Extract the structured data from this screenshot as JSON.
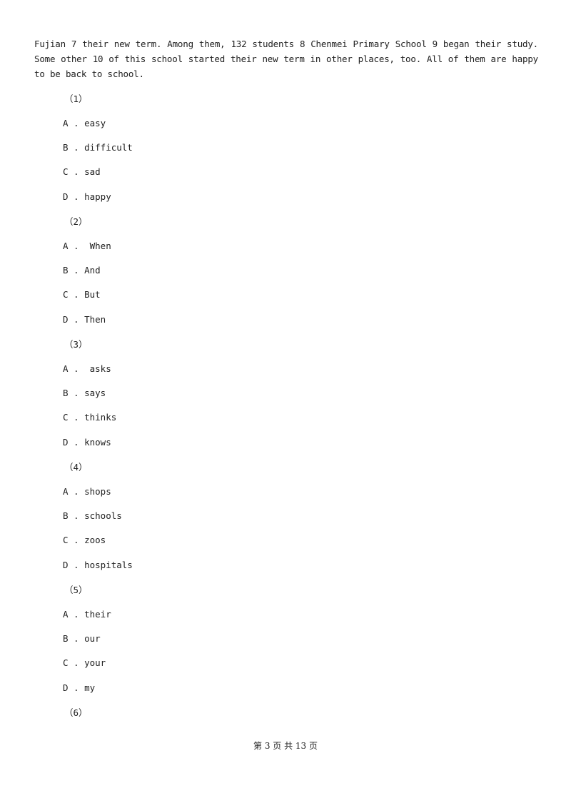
{
  "passage": "Fujian 7 their new term. Among them, 132 students 8 Chenmei Primary School 9 began their study. Some other 10 of this school started their new term in other places, too. All of them are happy to be back to school.",
  "questions": [
    {
      "label": "（1）",
      "options": [
        "A . easy",
        "B . difficult",
        "C . sad",
        "D . happy"
      ]
    },
    {
      "label": "（2）",
      "options": [
        "A .  When",
        "B . And",
        "C . But",
        "D . Then"
      ]
    },
    {
      "label": "（3）",
      "options": [
        "A .  asks",
        "B . says",
        "C . thinks",
        "D . knows"
      ]
    },
    {
      "label": "（4）",
      "options": [
        "A . shops",
        "B . schools",
        "C . zoos",
        "D . hospitals"
      ]
    },
    {
      "label": "（5）",
      "options": [
        "A . their",
        "B . our",
        "C . your",
        "D . my"
      ]
    },
    {
      "label": "（6）",
      "options": []
    }
  ],
  "footer": "第 3 页 共 13 页"
}
